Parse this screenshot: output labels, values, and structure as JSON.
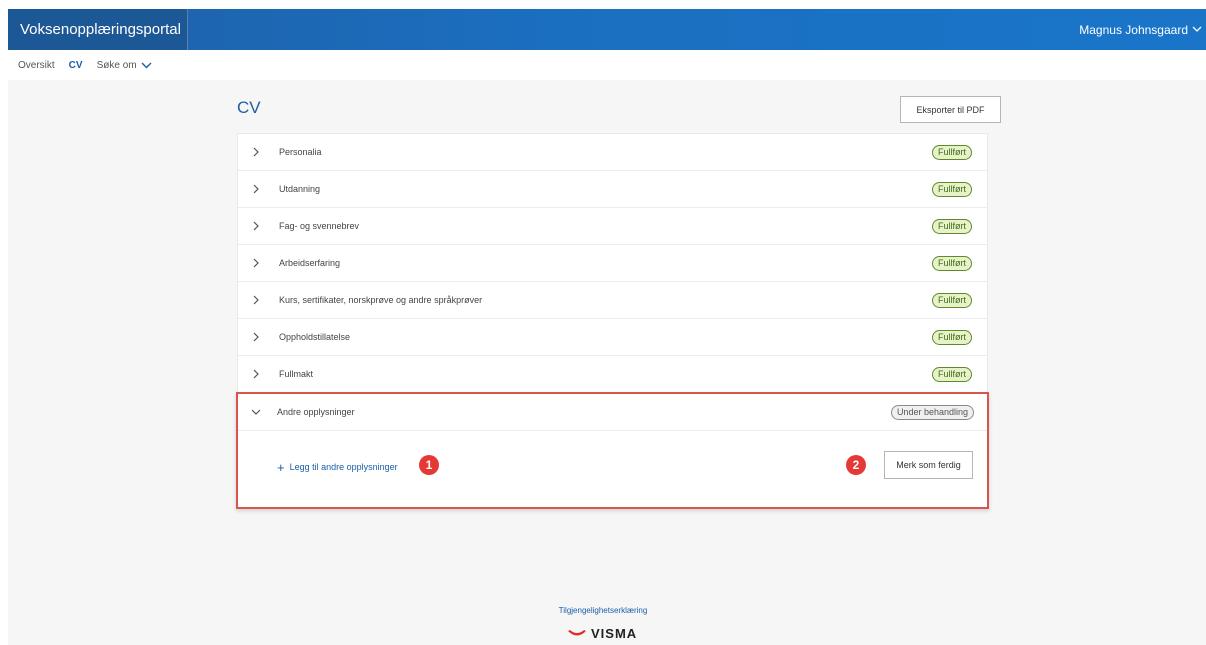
{
  "header": {
    "app_title": "Voksenopplæringsportal",
    "user_name": "Magnus Johnsgaard"
  },
  "nav": {
    "items": [
      "Oversikt",
      "CV"
    ],
    "dropdown_label": "Søke om"
  },
  "page": {
    "title": "CV",
    "export_button": "Eksporter til PDF"
  },
  "sections": [
    {
      "label": "Personalia",
      "status": "Fullført"
    },
    {
      "label": "Utdanning",
      "status": "Fullført"
    },
    {
      "label": "Fag- og svennebrev",
      "status": "Fullført"
    },
    {
      "label": "Arbeidserfaring",
      "status": "Fullført"
    },
    {
      "label": "Kurs, sertifikater, norskprøve og andre språkprøver",
      "status": "Fullført"
    },
    {
      "label": "Oppholdstillatelse",
      "status": "Fullført"
    },
    {
      "label": "Fullmakt",
      "status": "Fullført"
    }
  ],
  "expanded_section": {
    "label": "Andre opplysninger",
    "status": "Under behandling",
    "add_link": "Legg til andre opplysninger",
    "finish_button": "Merk som ferdig",
    "marker_1": "1",
    "marker_2": "2"
  },
  "footer": {
    "accessibility_link": "Tilgjengelighetserklæring",
    "logo_text": "VISMA"
  },
  "colors": {
    "header_blue": "#1b6fc0",
    "link_blue": "#1a5ea8",
    "done_badge": "#5f8a2c",
    "annotation_red": "#e53935"
  }
}
